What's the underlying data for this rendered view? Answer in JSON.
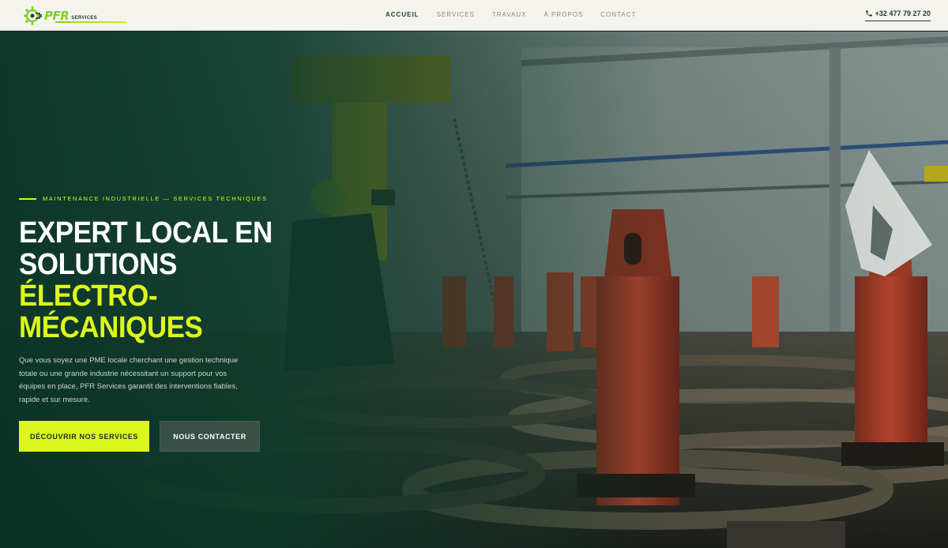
{
  "brand": {
    "logo_main": "PFR",
    "logo_sub": "SERVICES",
    "accent_color": "#dcf71c",
    "logo_color": "#7ed321",
    "dark_color": "#1f3a2c"
  },
  "nav": {
    "items": [
      {
        "label": "ACCUEIL",
        "active": true
      },
      {
        "label": "SERVICES",
        "active": false
      },
      {
        "label": "TRAVAUX",
        "active": false
      },
      {
        "label": "À PROPOS",
        "active": false
      },
      {
        "label": "CONTACT",
        "active": false
      }
    ]
  },
  "header": {
    "phone": "+32 477 79 27 20",
    "phone_icon": "phone-icon"
  },
  "hero": {
    "eyebrow": "MAINTENANCE INDUSTRIELLE — SERVICES TECHNIQUES",
    "title_line1": "EXPERT LOCAL EN",
    "title_line2": "SOLUTIONS",
    "title_accent": "ÉLECTRO-MÉCANIQUES",
    "description": "Que vous soyez une PME locale cherchant une gestion technique totale ou une grande industrie nécessitant un support pour vos équipes en place, PFR Services garantit des interventions fiables, rapide et sur mesure.",
    "cta_primary": "DÉCOUVRIR NOS SERVICES",
    "cta_secondary": "NOUS CONTACTER"
  }
}
